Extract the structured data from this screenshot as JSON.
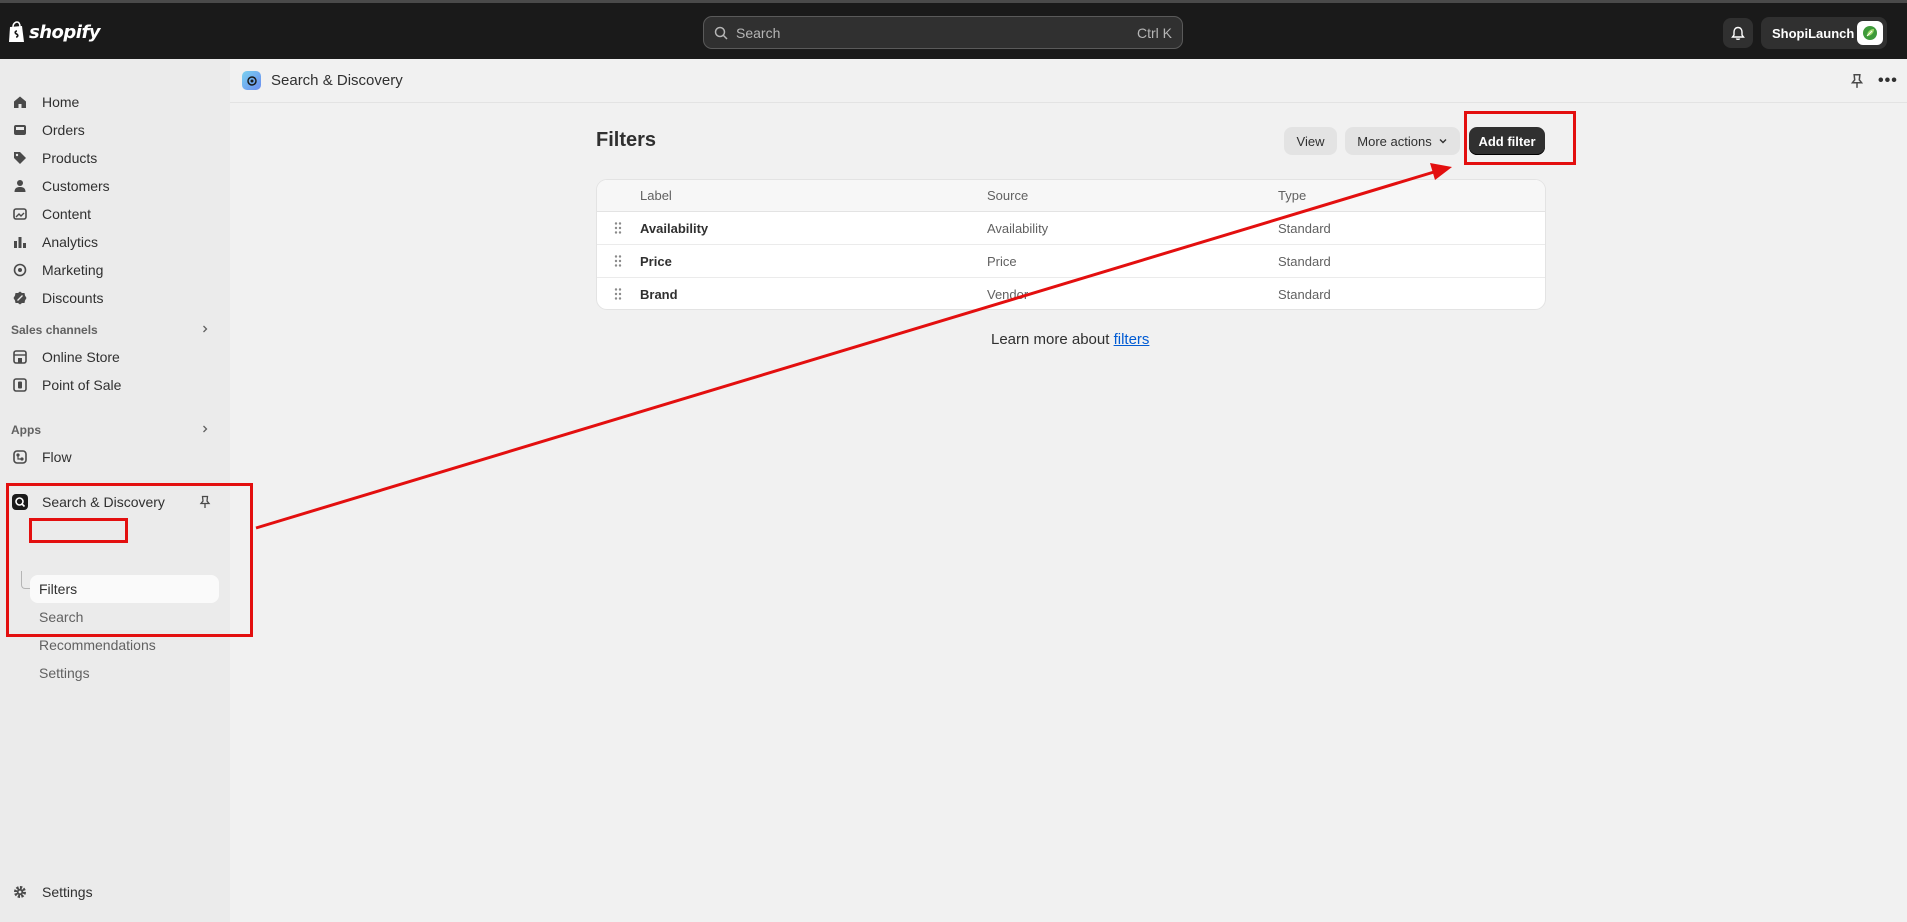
{
  "topbar": {
    "logo_text": "shopify",
    "search_placeholder": "Search",
    "search_shortcut": "Ctrl K",
    "store_name": "ShopiLaunch"
  },
  "sidebar": {
    "items": [
      {
        "label": "Home",
        "icon": "home-icon"
      },
      {
        "label": "Orders",
        "icon": "inbox-icon"
      },
      {
        "label": "Products",
        "icon": "tag-icon"
      },
      {
        "label": "Customers",
        "icon": "person-icon"
      },
      {
        "label": "Content",
        "icon": "image-icon"
      },
      {
        "label": "Analytics",
        "icon": "bar-chart-icon"
      },
      {
        "label": "Marketing",
        "icon": "target-icon"
      },
      {
        "label": "Discounts",
        "icon": "discount-icon"
      }
    ],
    "sales_channels_label": "Sales channels",
    "sales_channels": [
      {
        "label": "Online Store",
        "icon": "store-icon"
      },
      {
        "label": "Point of Sale",
        "icon": "pos-icon"
      }
    ],
    "apps_label": "Apps",
    "apps": [
      {
        "label": "Flow",
        "icon": "flow-icon"
      }
    ],
    "pinned_app": {
      "label": "Search & Discovery",
      "subitems": [
        "Filters",
        "Search",
        "Recommendations",
        "Settings"
      ]
    },
    "settings_label": "Settings"
  },
  "page_header": {
    "app_title": "Search & Discovery"
  },
  "main": {
    "title": "Filters",
    "view_label": "View",
    "more_actions_label": "More actions",
    "add_filter_label": "Add filter",
    "table": {
      "columns": [
        "Label",
        "Source",
        "Type"
      ],
      "rows": [
        {
          "label": "Availability",
          "source": "Availability",
          "type": "Standard"
        },
        {
          "label": "Price",
          "source": "Price",
          "type": "Standard"
        },
        {
          "label": "Brand",
          "source": "Vendor",
          "type": "Standard"
        }
      ]
    },
    "learn_more_prefix": "Learn more about ",
    "learn_more_link": "filters"
  },
  "colors": {
    "topbar": "#1a1a1a",
    "primary_button": "#303030",
    "link": "#005bd3",
    "annotation": "#e30f0f"
  }
}
